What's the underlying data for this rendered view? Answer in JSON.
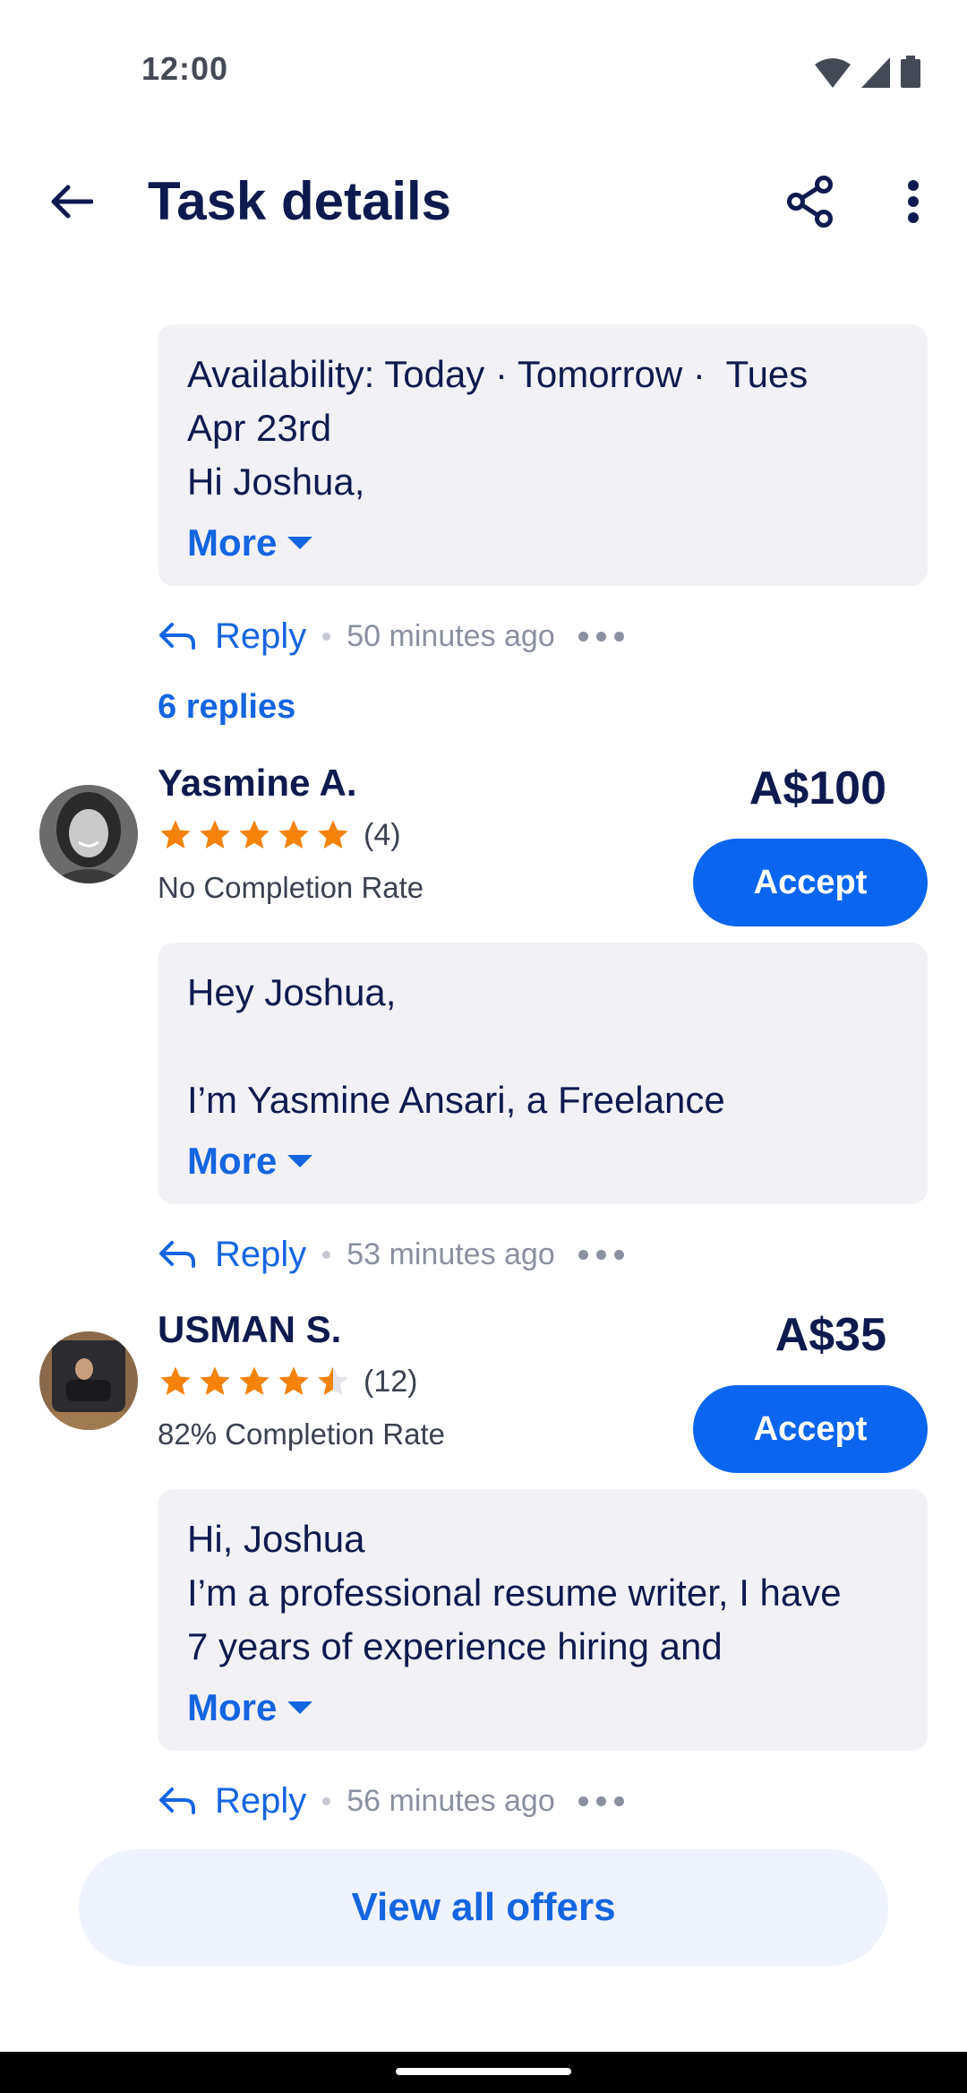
{
  "status_bar": {
    "time": "12:00",
    "icons": [
      "wifi-icon",
      "signal-icon",
      "battery-icon"
    ]
  },
  "header": {
    "title": "Task details",
    "icons": [
      "back-arrow-icon",
      "share-icon",
      "more-vertical-icon"
    ]
  },
  "thread_top": {
    "message": "Availability: Today · Tomorrow ·  Tues\nApr 23rd\nHi Joshua,",
    "more_label": "More",
    "reply_label": "Reply",
    "timestamp": "50 minutes ago",
    "replies_label": "6 replies"
  },
  "offers": [
    {
      "name": "Yasmine A.",
      "rating": 5,
      "review_count": "(4)",
      "completion": "No Completion Rate",
      "price": "A$100",
      "accept_label": "Accept",
      "message": "Hey Joshua,\n\nI’m Yasmine Ansari, a Freelance",
      "more_label": "More",
      "reply_label": "Reply",
      "timestamp": "53 minutes ago"
    },
    {
      "name": "USMAN S.",
      "rating": 4.5,
      "review_count": "(12)",
      "completion": "82% Completion Rate",
      "price": "A$35",
      "accept_label": "Accept",
      "message": "Hi, Joshua\nI’m a professional resume writer, I have\n7 years of experience hiring and",
      "more_label": "More",
      "reply_label": "Reply",
      "timestamp": "56 minutes ago"
    }
  ],
  "footer": {
    "view_all_label": "View all offers"
  },
  "colors": {
    "primary": "#0a66f0",
    "link": "#1565e0",
    "star": "#f5820b",
    "bubble": "#f2f2f6",
    "text": "#0e1a4f"
  }
}
